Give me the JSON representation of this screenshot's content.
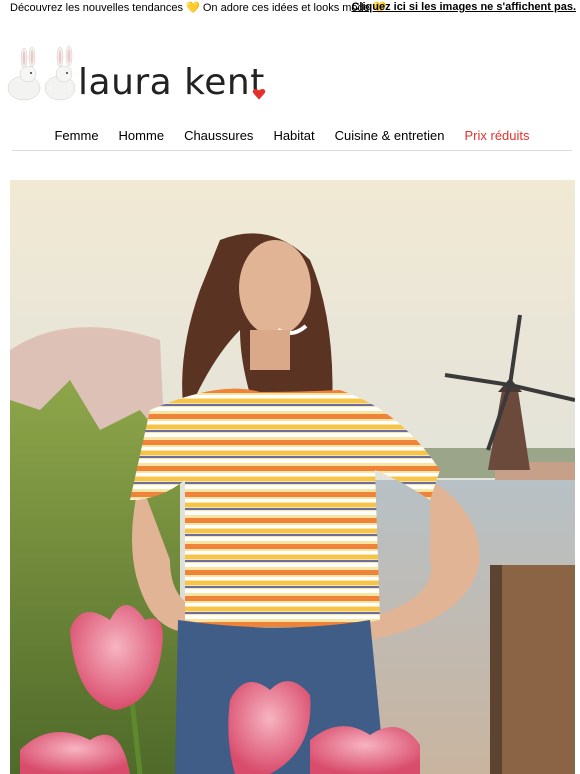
{
  "preheader": {
    "text": "Découvrez les nouvelles tendances 💛 On adore ces idées et looks mode 💛",
    "link": "Cliquez ici si les images ne s'affichent pas."
  },
  "brand": {
    "name": "laura kent",
    "accent_color": "#e4312b"
  },
  "nav": {
    "items": [
      {
        "label": "Femme"
      },
      {
        "label": "Homme"
      },
      {
        "label": "Chaussures"
      },
      {
        "label": "Habitat"
      },
      {
        "label": "Cuisine & entretien"
      },
      {
        "label": "Prix réduits",
        "color": "#e4312b"
      }
    ]
  },
  "hero": {
    "icon": "hero-photo",
    "alt_colors": {
      "sky": "#efe6d2",
      "water": "#b9b3ad",
      "reeds": "#6e8a3c"
    }
  }
}
